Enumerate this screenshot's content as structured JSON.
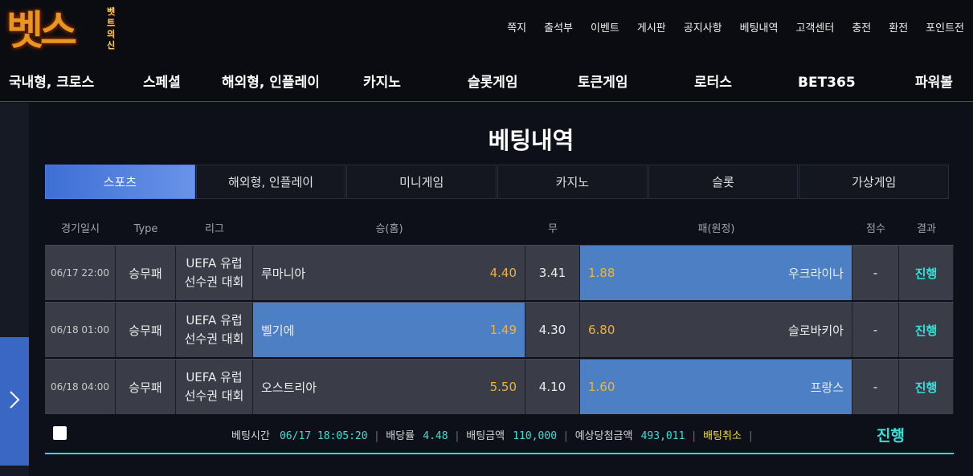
{
  "logo": {
    "main": "벳스",
    "side": "벳 트 의 신"
  },
  "top_nav": [
    "쪽지",
    "출석부",
    "이벤트",
    "게시판",
    "공지사항",
    "베팅내역",
    "고객센터",
    "충전",
    "환전",
    "포인트전"
  ],
  "main_nav": [
    "국내형, 크로스",
    "스페셜",
    "해외형, 인플레이",
    "카지노",
    "슬롯게임",
    "토큰게임",
    "로터스",
    "BET365",
    "파워볼"
  ],
  "page_title": "베팅내역",
  "tabs": [
    "스포츠",
    "해외형, 인플레이",
    "미니게임",
    "카지노",
    "슬롯",
    "가상게임"
  ],
  "active_tab": "스포츠",
  "columns": [
    "경기일시",
    "Type",
    "리그",
    "승(홈)",
    "무",
    "패(원정)",
    "점수",
    "결과"
  ],
  "rows": [
    {
      "date": "06/17 22:00",
      "type": "승무패",
      "league_line1": "UEFA 유럽",
      "league_line2": "선수권 대회",
      "home": "루마니아",
      "home_odd": "4.40",
      "draw": "3.41",
      "away_odd": "1.88",
      "away": "우크라이나",
      "score": "-",
      "result": "진행",
      "selected": "away"
    },
    {
      "date": "06/18 01:00",
      "type": "승무패",
      "league_line1": "UEFA 유럽",
      "league_line2": "선수권 대회",
      "home": "벨기에",
      "home_odd": "1.49",
      "draw": "4.30",
      "away_odd": "6.80",
      "away": "슬로바키아",
      "score": "-",
      "result": "진행",
      "selected": "home"
    },
    {
      "date": "06/18 04:00",
      "type": "승무패",
      "league_line1": "UEFA 유럽",
      "league_line2": "선수권 대회",
      "home": "오스트리아",
      "home_odd": "5.50",
      "draw": "4.10",
      "away_odd": "1.60",
      "away": "프랑스",
      "score": "-",
      "result": "진행",
      "selected": "away"
    }
  ],
  "summary": {
    "bet_time_label": "베팅시간",
    "bet_time": "06/17 18:05:20",
    "odds_label": "배당률",
    "odds": "4.48",
    "amount_label": "배팅금액",
    "amount": "110,000",
    "expected_label": "예상당첨금액",
    "expected": "493,011",
    "cancel_label": "배팅취소",
    "status": "진행"
  },
  "colors": {
    "accent_blue": "#4d7fc4",
    "odd_orange": "#f2b332",
    "result_cyan": "#36e0d8",
    "cancel_yellow": "#f0e03a"
  }
}
